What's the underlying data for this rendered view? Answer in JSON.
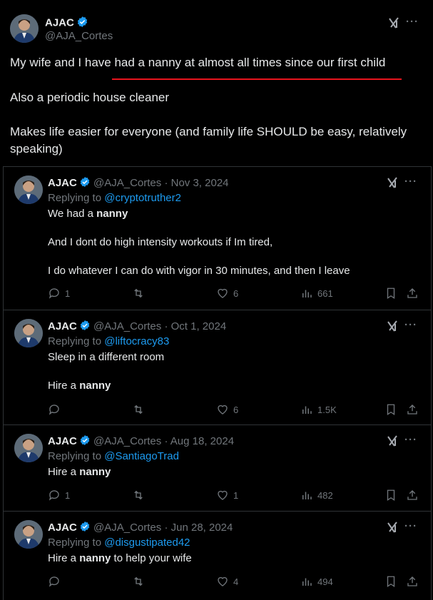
{
  "main_post": {
    "author": {
      "name": "AJAC",
      "handle": "@AJA_Cortes"
    },
    "paragraphs": [
      "My wife and I have had a nanny at almost all times since our first child",
      "Also a periodic house cleaner",
      "Makes life easier for everyone (and family life SHOULD be easy, relatively speaking)"
    ]
  },
  "replies": [
    {
      "name": "AJAC",
      "handle": "@AJA_Cortes",
      "date": "Nov 3, 2024",
      "replying_prefix": "Replying to ",
      "replying_to": "@cryptotruther2",
      "lines": [
        {
          "pre": "We had a ",
          "bold": "nanny",
          "post": ""
        },
        {
          "pre": "And I dont do high intensity workouts if Im tired,",
          "bold": "",
          "post": ""
        },
        {
          "pre": "I do whatever I can do with vigor in 30 minutes, and then I leave",
          "bold": "",
          "post": ""
        }
      ],
      "stats": {
        "replies": "1",
        "reposts": "",
        "likes": "6",
        "views": "661"
      }
    },
    {
      "name": "AJAC",
      "handle": "@AJA_Cortes",
      "date": "Oct 1, 2024",
      "replying_prefix": "Replying to ",
      "replying_to": "@liftocracy83",
      "lines": [
        {
          "pre": "Sleep in a different room",
          "bold": "",
          "post": ""
        },
        {
          "pre": "Hire a ",
          "bold": "nanny",
          "post": ""
        }
      ],
      "stats": {
        "replies": "",
        "reposts": "",
        "likes": "6",
        "views": "1.5K"
      }
    },
    {
      "name": "AJAC",
      "handle": "@AJA_Cortes",
      "date": "Aug 18, 2024",
      "replying_prefix": "Replying to ",
      "replying_to": "@SantiagoTrad",
      "lines": [
        {
          "pre": "Hire a ",
          "bold": "nanny",
          "post": ""
        }
      ],
      "stats": {
        "replies": "1",
        "reposts": "",
        "likes": "1",
        "views": "482"
      }
    },
    {
      "name": "AJAC",
      "handle": "@AJA_Cortes",
      "date": "Jun 28, 2024",
      "replying_prefix": "Replying to ",
      "replying_to": "@disgustipated42",
      "lines": [
        {
          "pre": "Hire a ",
          "bold": "nanny",
          "post": " to help your wife"
        }
      ],
      "stats": {
        "replies": "",
        "reposts": "",
        "likes": "4",
        "views": "494"
      }
    }
  ],
  "meta": {
    "date_separator": " · ",
    "more_label": "···"
  },
  "colors": {
    "accent": "#1d9bf0",
    "underline": "#e8141d",
    "muted": "#71767b"
  }
}
